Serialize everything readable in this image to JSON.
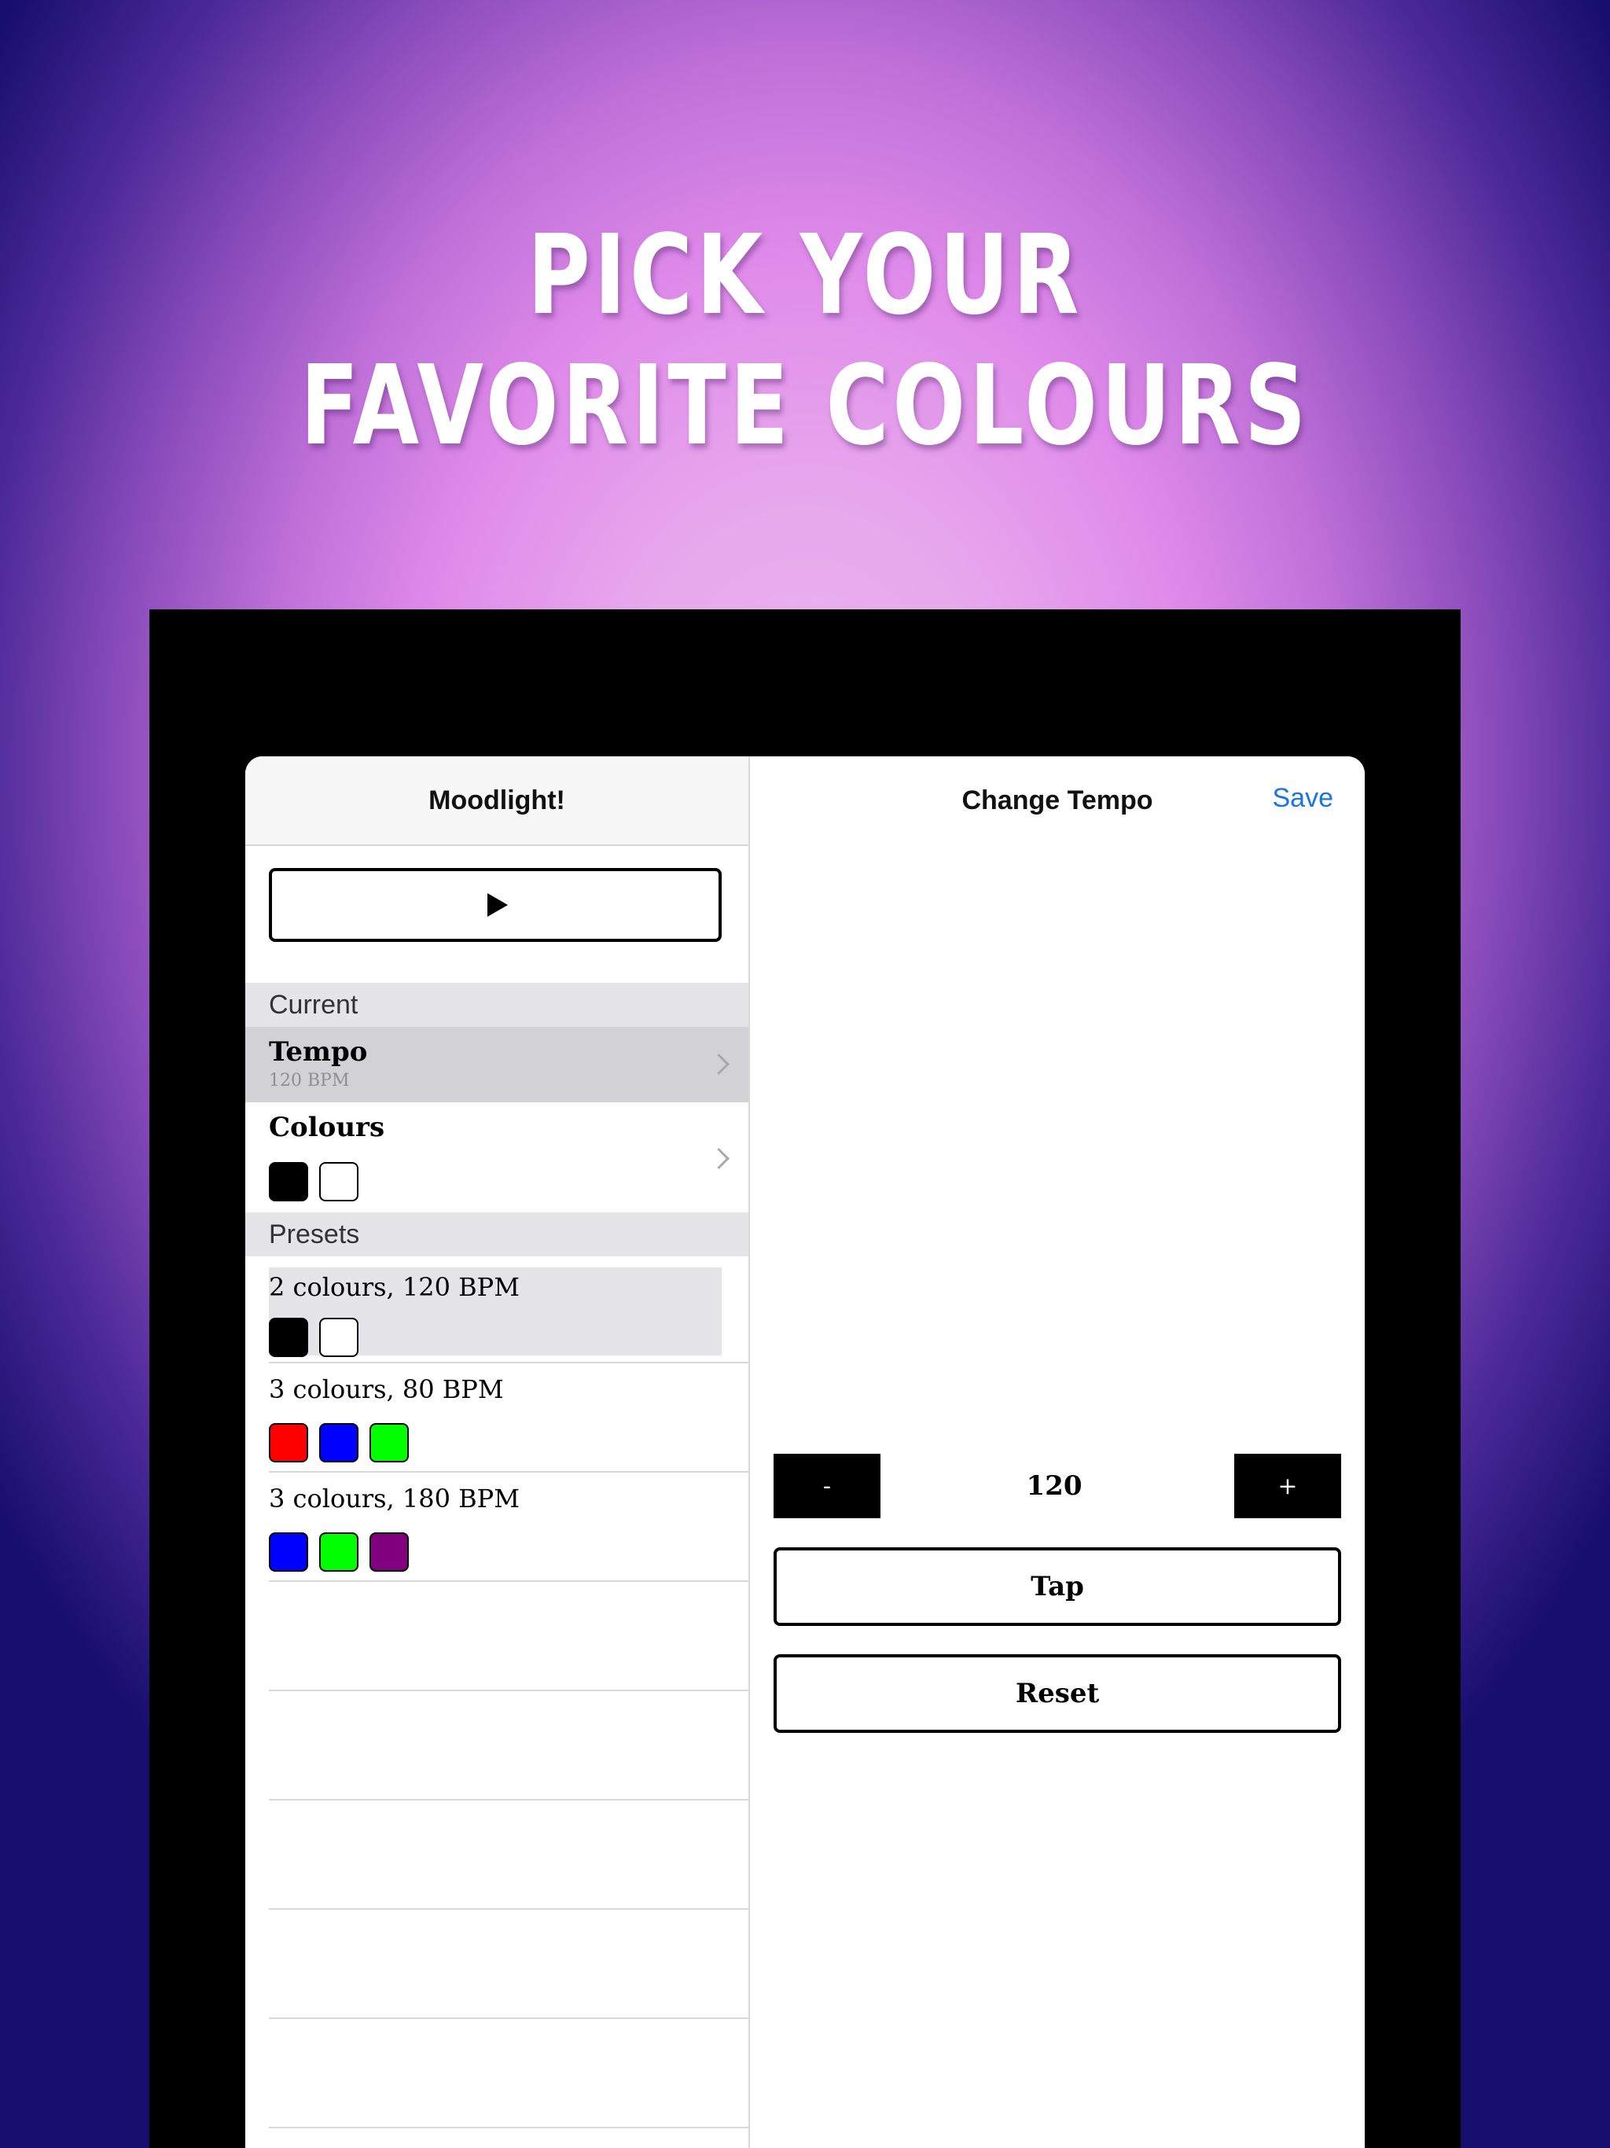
{
  "headline": {
    "line1": "PICK YOUR",
    "line2": "FAVORITE COLOURS"
  },
  "master": {
    "title": "Moodlight!",
    "play_icon": "play-icon",
    "sections": {
      "current": "Current",
      "presets": "Presets"
    },
    "tempo": {
      "label": "Tempo",
      "value": "120 BPM"
    },
    "colours": {
      "label": "Colours",
      "swatches": [
        "#000000",
        "#ffffff"
      ]
    },
    "presets": [
      {
        "label": "2 colours, 120 BPM",
        "swatches": [
          "#000000",
          "#ffffff"
        ]
      },
      {
        "label": "3 colours, 80 BPM",
        "swatches": [
          "#ff0000",
          "#0000ff",
          "#00ff00"
        ]
      },
      {
        "label": "3 colours, 180 BPM",
        "swatches": [
          "#0000ff",
          "#00ff00",
          "#800080"
        ]
      }
    ]
  },
  "detail": {
    "title": "Change Tempo",
    "save_label": "Save",
    "decrement_label": "-",
    "increment_label": "+",
    "tempo_value": "120",
    "tap_label": "Tap",
    "reset_label": "Reset"
  },
  "colors": {
    "accent_blue": "#1a73e8",
    "selected_row": "#d1d1d6",
    "section_bg": "#e5e5e7"
  }
}
